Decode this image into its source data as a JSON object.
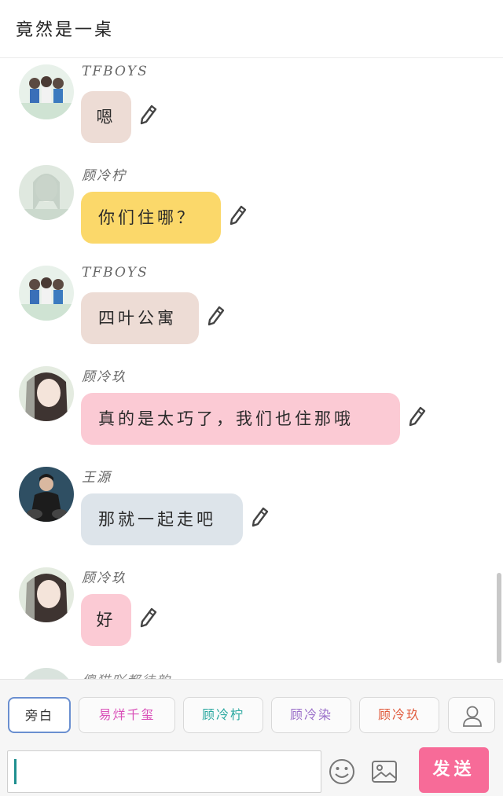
{
  "header": {
    "title": "竟然是一桌"
  },
  "messages": [
    {
      "sender": "TFBOYS",
      "text": "嗯"
    },
    {
      "sender": "顾冷柠",
      "text": "你们住哪？"
    },
    {
      "sender": "TFBOYS",
      "text": "四叶公寓"
    },
    {
      "sender": "顾冷玖",
      "text": "真的是太巧了，我们也住那哦"
    },
    {
      "sender": "王源",
      "text": "那就一起走吧"
    },
    {
      "sender": "顾冷玖",
      "text": "好"
    }
  ],
  "partial_sender": "傻猫吖都徒韵",
  "roles": [
    {
      "label": "旁白",
      "color": "#333333"
    },
    {
      "label": "易烊千玺",
      "color": "#d94fb8"
    },
    {
      "label": "顾冷柠",
      "color": "#2aa8a0"
    },
    {
      "label": "顾冷染",
      "color": "#9a6fc9"
    },
    {
      "label": "顾冷玖",
      "color": "#e05a3c"
    }
  ],
  "icons": {
    "edit": "pencil-icon",
    "user": "user-icon",
    "emoji": "smiley-icon",
    "image": "image-icon"
  },
  "input": {
    "value": ""
  },
  "send_label": "发送",
  "colors": {
    "send": "#f76b98",
    "active_role_border": "#6a8fd0",
    "caret": "#1e8f8f"
  }
}
